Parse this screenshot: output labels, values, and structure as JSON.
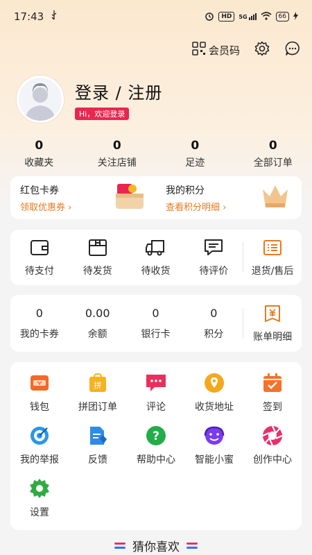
{
  "status_bar": {
    "time": "17:43",
    "hd": "HD",
    "signal": "5G",
    "battery": "66"
  },
  "header": {
    "member_code": "会员码"
  },
  "profile": {
    "title": "登录 / 注册",
    "badge": "Hi，欢迎登录"
  },
  "stats": [
    {
      "value": "0",
      "label": "收藏夹"
    },
    {
      "value": "0",
      "label": "关注店铺"
    },
    {
      "value": "0",
      "label": "足迹"
    },
    {
      "value": "0",
      "label": "全部订单"
    }
  ],
  "promos": [
    {
      "title": "红包卡券",
      "sub": "领取优惠券 ›"
    },
    {
      "title": "我的积分",
      "sub": "查看积分明细 ›"
    }
  ],
  "orders": [
    {
      "label": "待支付",
      "icon": "wallet-icon"
    },
    {
      "label": "待发货",
      "icon": "box-icon"
    },
    {
      "label": "待收货",
      "icon": "truck-icon"
    },
    {
      "label": "待评价",
      "icon": "comment-icon"
    },
    {
      "label": "退货/售后",
      "icon": "return-icon"
    }
  ],
  "wallet": [
    {
      "value": "0",
      "label": "我的卡券"
    },
    {
      "value": "0.00",
      "label": "余额"
    },
    {
      "value": "0",
      "label": "银行卡"
    },
    {
      "value": "0",
      "label": "积分"
    },
    {
      "label": "账单明细",
      "icon": "bill-icon"
    }
  ],
  "services": [
    {
      "label": "钱包",
      "icon": "wallet-icon",
      "color": "#f26a2a"
    },
    {
      "label": "拼团订单",
      "icon": "group-buy-icon",
      "color": "#f7b21f"
    },
    {
      "label": "评论",
      "icon": "chat-icon",
      "color": "#ea2f5d"
    },
    {
      "label": "收货地址",
      "icon": "location-icon",
      "color": "#f4a81c"
    },
    {
      "label": "签到",
      "icon": "calendar-icon",
      "color": "#f5722b"
    },
    {
      "label": "我的举报",
      "icon": "target-icon",
      "color": "#2a97e8"
    },
    {
      "label": "反馈",
      "icon": "feedback-icon",
      "color": "#2d8ce4"
    },
    {
      "label": "帮助中心",
      "icon": "help-icon",
      "color": "#23ad4a"
    },
    {
      "label": "智能小蜜",
      "icon": "assistant-icon",
      "color": "#7a3cf0"
    },
    {
      "label": "创作中心",
      "icon": "aperture-icon",
      "color": "#ea2f6b"
    },
    {
      "label": "设置",
      "icon": "settings-icon",
      "color": "#2eac42"
    }
  ],
  "guess": {
    "title": "猜你喜欢"
  }
}
